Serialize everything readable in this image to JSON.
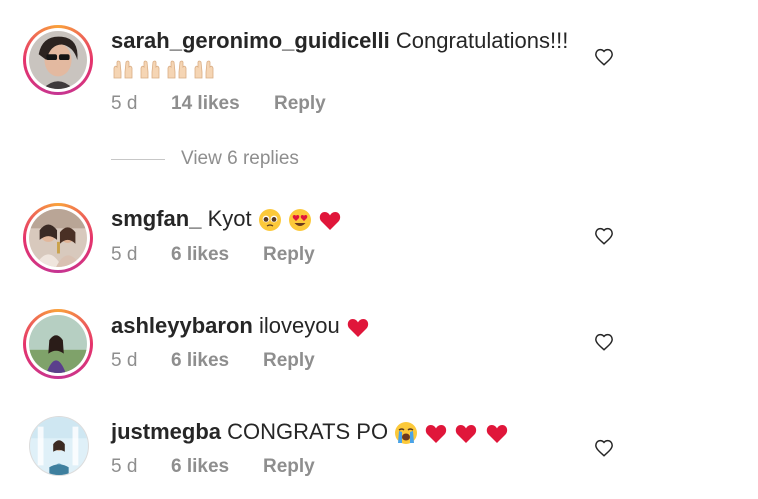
{
  "comments": [
    {
      "username": "sarah_geronimo_guidicelli",
      "text": "Congratulations!!!",
      "emojis": [
        "raising-hands-emoji",
        "raising-hands-emoji",
        "raising-hands-emoji",
        "raising-hands-emoji"
      ],
      "time": "5 d",
      "likes": "14 likes",
      "reply": "Reply"
    },
    {
      "username": "smgfan_",
      "text": "Kyot",
      "emojis": [
        "pleading-face-emoji",
        "heart-eyes-emoji",
        "red-heart-emoji"
      ],
      "time": "5 d",
      "likes": "6 likes",
      "reply": "Reply"
    },
    {
      "username": "ashleyybaron",
      "text": "iloveyou",
      "emojis": [
        "red-heart-emoji"
      ],
      "time": "5 d",
      "likes": "6 likes",
      "reply": "Reply"
    },
    {
      "username": "justmegba",
      "text": "CONGRATS PO",
      "emojis": [
        "loudly-crying-face-emoji",
        "red-heart-emoji",
        "red-heart-emoji",
        "red-heart-emoji"
      ],
      "time": "5 d",
      "likes": "6 likes",
      "reply": "Reply"
    }
  ],
  "view_replies": "View 6 replies",
  "colors": {
    "text": "#262626",
    "secondary": "#8e8e8e",
    "heart": "#e0163a",
    "story_ring_start": "#f9a23b",
    "story_ring_end": "#c53593"
  }
}
